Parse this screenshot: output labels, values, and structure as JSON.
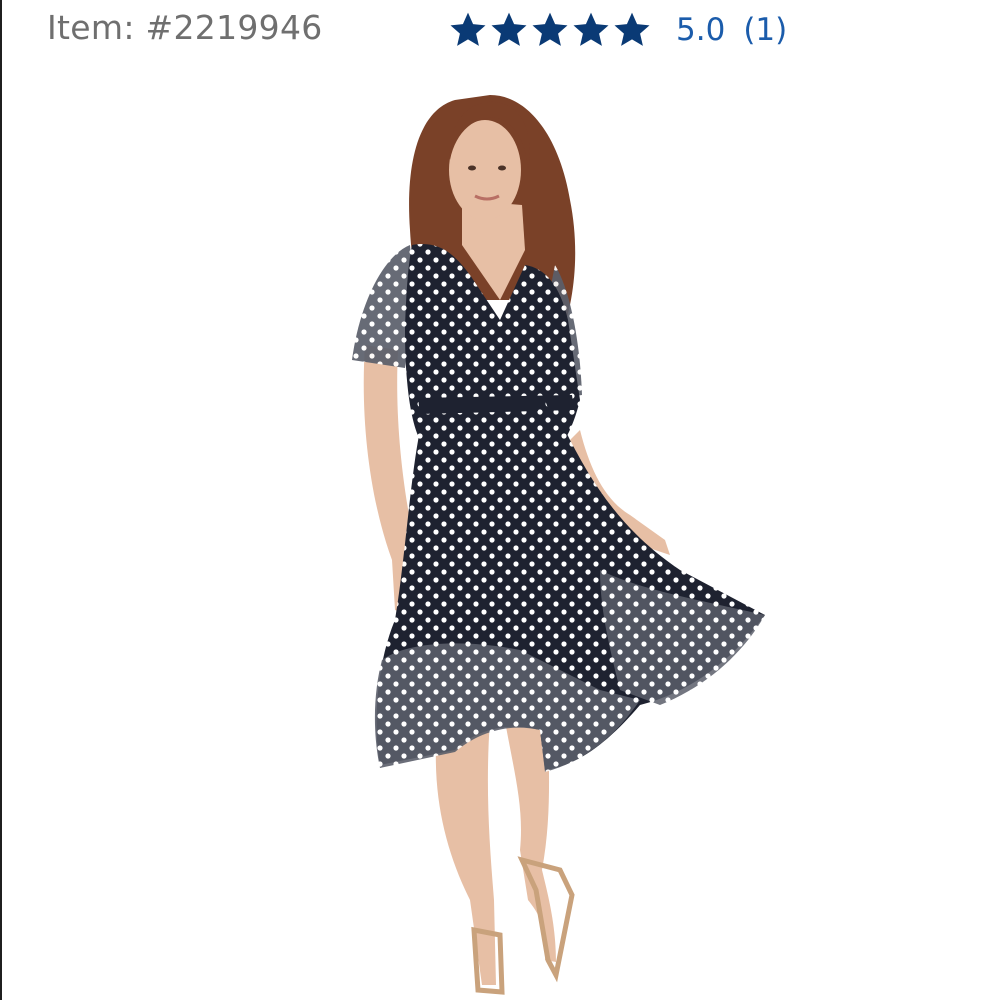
{
  "header": {
    "item_number": "Item: #2219946",
    "rating": {
      "stars": 5,
      "max_stars": 5,
      "score": "5.0",
      "review_count": "(1)",
      "star_color": "#0a3a75",
      "link_color": "#1b5cab"
    }
  },
  "product_image": {
    "icon": "product-photo",
    "dress_color": "#1e2230",
    "dot_color": "#ffffff",
    "hair_color": "#7a4128",
    "skin_color": "#e7bfa5"
  }
}
